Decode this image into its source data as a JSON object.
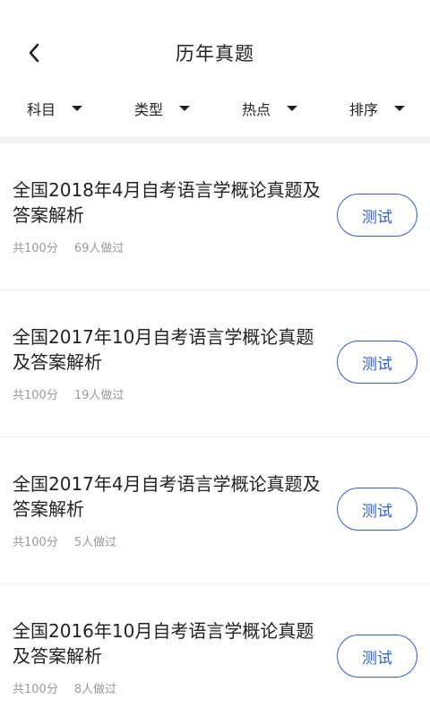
{
  "header": {
    "title": "历年真题",
    "back_icon": "chevron-left-icon"
  },
  "filters": [
    {
      "label": "科目"
    },
    {
      "label": "类型"
    },
    {
      "label": "热点"
    },
    {
      "label": "排序"
    }
  ],
  "items": [
    {
      "title": "全国2018年4月自考语言学概论真题及答案解析",
      "score": "共100分",
      "count": "69人做过",
      "action": "测试"
    },
    {
      "title": "全国2017年10月自考语言学概论真题及答案解析",
      "score": "共100分",
      "count": "19人做过",
      "action": "测试"
    },
    {
      "title": "全国2017年4月自考语言学概论真题及答案解析",
      "score": "共100分",
      "count": "5人做过",
      "action": "测试"
    },
    {
      "title": "全国2016年10月自考语言学概论真题及答案解析",
      "score": "共100分",
      "count": "8人做过",
      "action": "测试"
    }
  ],
  "colors": {
    "accent": "#2b5fd6",
    "meta_text": "#9a9a9a"
  }
}
